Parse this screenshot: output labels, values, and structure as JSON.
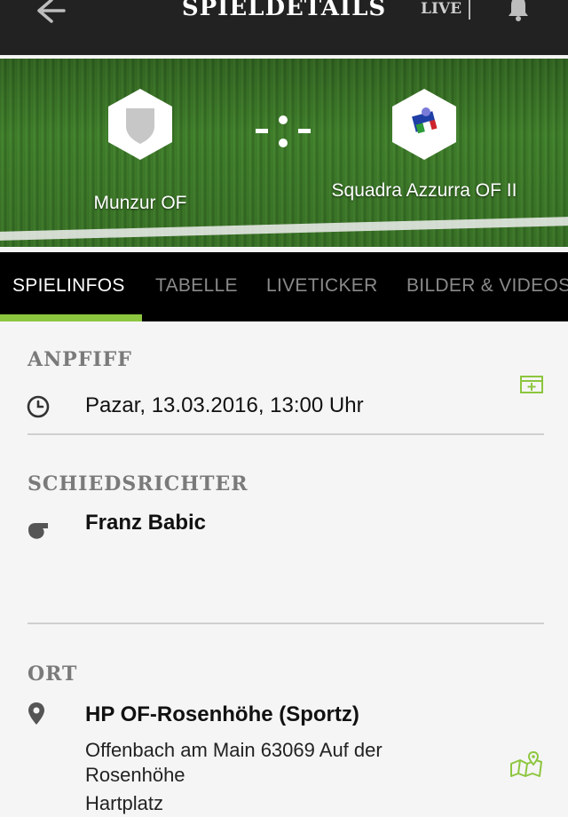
{
  "header": {
    "title": "SPIELDETAILS",
    "live_label": "LIVE",
    "back_icon": "arrow-left-icon",
    "bell_icon": "bell-icon"
  },
  "match": {
    "home_team": "Munzur OF",
    "away_team": "Squadra Azzurra OF II",
    "score": "-:-"
  },
  "tabs": [
    {
      "label": "SPIELINFOS",
      "active": true
    },
    {
      "label": "TABELLE",
      "active": false
    },
    {
      "label": "LIVETICKER",
      "active": false
    },
    {
      "label": "BILDER & VIDEOS",
      "active": false
    }
  ],
  "kickoff": {
    "section_title": "ANPFIFF",
    "datetime": "Pazar, 13.03.2016, 13:00 Uhr",
    "icon": "clock-icon",
    "action_icon": "calendar-add-icon"
  },
  "referee": {
    "section_title": "SCHIEDSRICHTER",
    "name": "Franz Babic",
    "icon": "whistle-icon"
  },
  "venue": {
    "section_title": "ORT",
    "name": "HP OF-Rosenhöhe (Sportz)",
    "address_line1": "Offenbach am Main 63069 Auf der",
    "address_line2": "Rosenhöhe",
    "surface": "Hartplatz",
    "icon": "location-pin-icon",
    "action_icon": "map-icon"
  },
  "colors": {
    "accent": "#8dc63f",
    "topbar": "#222222",
    "tabbar": "#000000",
    "background": "#f5f5f5"
  }
}
